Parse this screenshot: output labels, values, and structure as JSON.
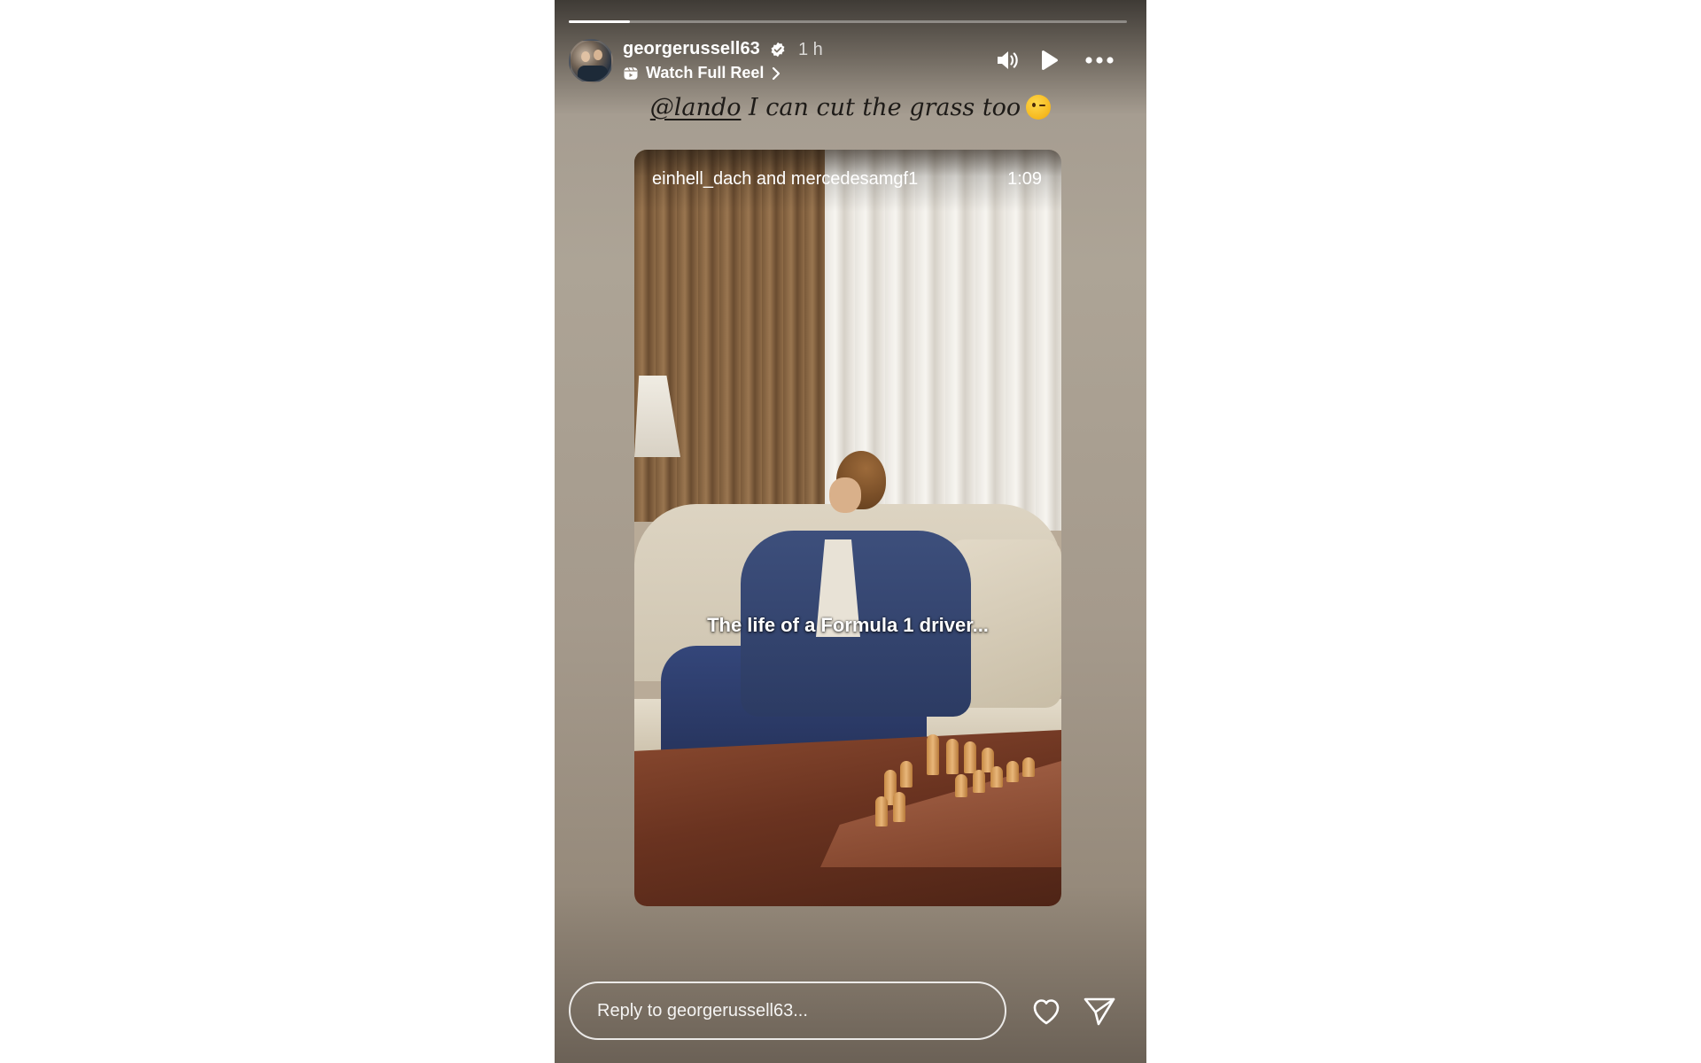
{
  "story": {
    "progress": 0.11,
    "username": "georgerussell63",
    "time_ago": "1 h",
    "reel_link": "Watch Full Reel",
    "caption_mention": "@lando",
    "caption_text": " I can cut the grass too"
  },
  "video": {
    "authors": "einhell_dach and mercedesamgf1",
    "duration": "1:09",
    "subtitle": "The life of a Formula 1 driver..."
  },
  "reply": {
    "placeholder": "Reply to georgerussell63..."
  },
  "icons": {
    "verified": "verified-badge-icon",
    "reel": "reel-icon",
    "chevron": "chevron-right-icon",
    "sound": "speaker-icon",
    "play": "play-icon",
    "more": "more-options-icon",
    "emoji": "winking-face-emoji",
    "like": "heart-icon",
    "share": "send-icon"
  },
  "colors": {
    "verified_badge": "#ffffff"
  }
}
